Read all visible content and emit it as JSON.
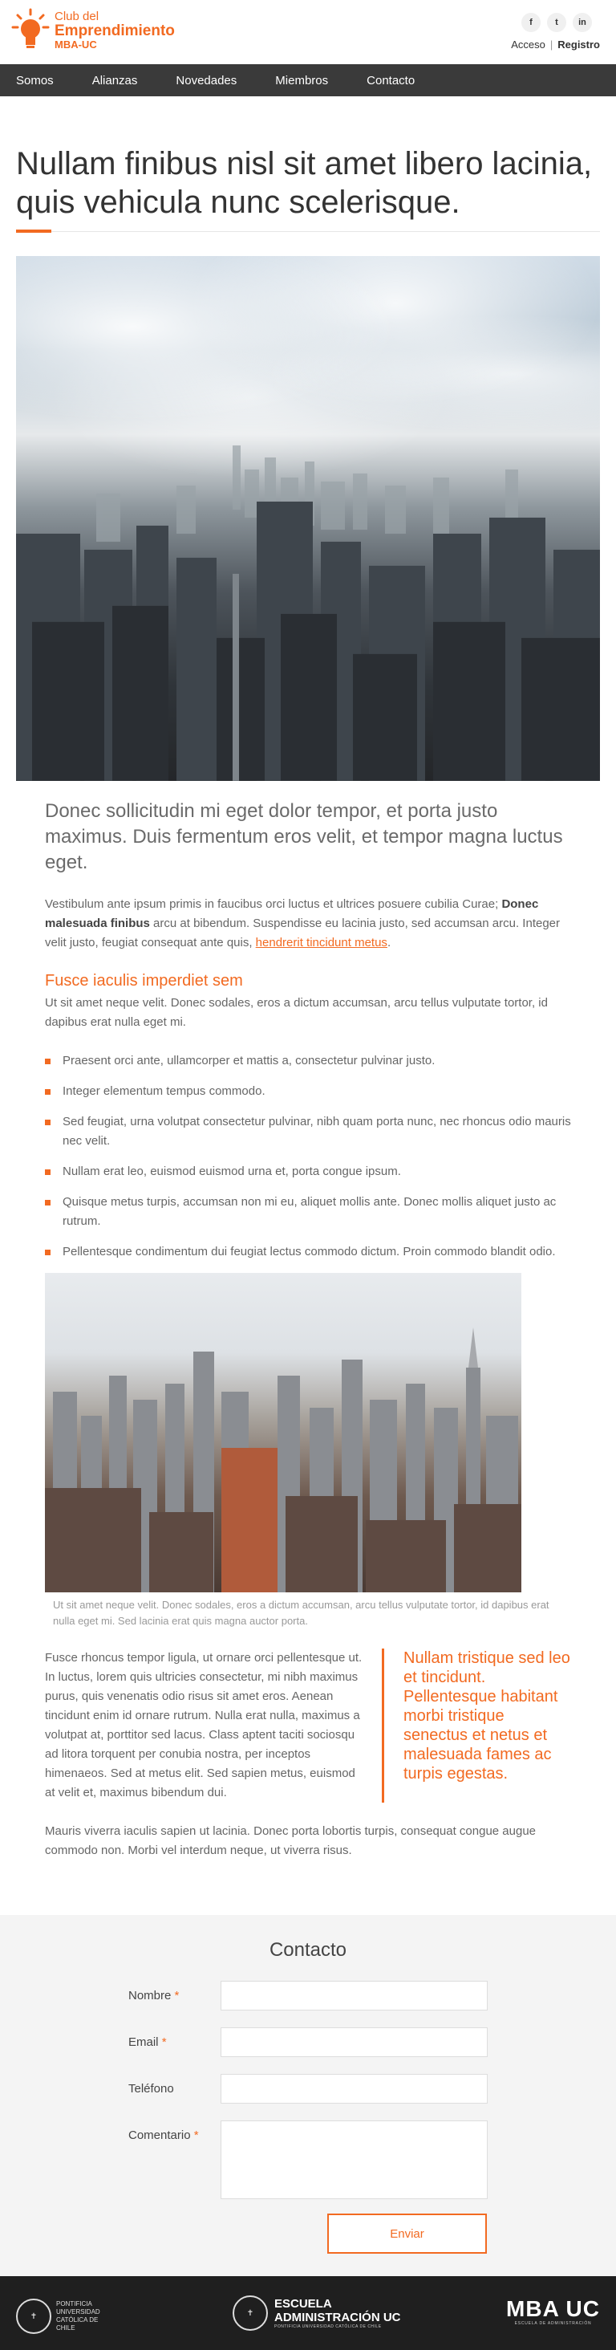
{
  "brand": {
    "line1": "Club del",
    "line2": "Emprendimiento",
    "line3": "MBA-UC",
    "accent": "#f26a21"
  },
  "social": [
    "f",
    "t",
    "in"
  ],
  "auth": {
    "login": "Acceso",
    "separator": "|",
    "register": "Registro"
  },
  "nav": [
    "Somos",
    "Alianzas",
    "Novedades",
    "Miembros",
    "Contacto"
  ],
  "article": {
    "title": "Nullam finibus nisl sit amet libero lacinia, quis vehicula nunc scelerisque.",
    "lead": "Donec sollicitudin mi eget dolor tempor, et porta justo maximus. Duis fermentum eros velit, et tempor magna luctus eget.",
    "para1_a": "Vestibulum ante ipsum primis in faucibus orci luctus et ultrices posuere cubilia Curae; ",
    "para1_bold": "Donec malesuada finibus",
    "para1_b": " arcu at bibendum. Suspendisse eu lacinia justo, sed accumsan arcu. Integer velit justo, feugiat consequat ante quis, ",
    "para1_link": "hendrerit tincidunt metus",
    "para1_end": ".",
    "subheading": "Fusce iaculis imperdiet sem",
    "para2": "Ut sit amet neque velit. Donec sodales, eros a dictum accumsan, arcu tellus vulputate tortor, id dapibus erat nulla eget mi.",
    "list": [
      "Praesent orci ante, ullamcorper et mattis a, consectetur pulvinar justo.",
      "Integer elementum tempus commodo.",
      "Sed feugiat, urna volutpat consectetur pulvinar, nibh quam porta nunc, nec rhoncus odio mauris nec velit.",
      "Nullam erat leo, euismod euismod urna et, porta congue ipsum.",
      "Quisque metus turpis, accumsan non mi eu, aliquet mollis ante. Donec mollis aliquet justo ac rutrum.",
      "Pellentesque condimentum dui feugiat lectus commodo dictum. Proin commodo blandit odio."
    ],
    "caption": "Ut sit amet neque velit. Donec sodales, eros a dictum accumsan, arcu tellus vulputate tortor, id dapibus erat nulla eget mi. Sed lacinia erat quis magna auctor porta.",
    "para3": "Fusce rhoncus tempor ligula, ut ornare orci pellentesque ut. In luctus, lorem quis ultricies consectetur, mi nibh maximus purus, quis venenatis odio risus sit amet eros. Aenean tincidunt enim id ornare rutrum. Nulla erat nulla, maximus a volutpat at, porttitor sed lacus. Class aptent taciti sociosqu ad litora torquent per conubia nostra, per inceptos himenaeos. Sed at metus elit. Sed sapien metus, euismod at velit et, maximus bibendum dui.",
    "pullquote": "Nullam tristique sed leo et tincidunt. Pellentesque habitant morbi tristique senectus et netus et malesuada fames ac turpis egestas.",
    "para4": "Mauris viverra iaculis sapien ut lacinia. Donec porta lobortis turpis, consequat congue augue commodo non. Morbi vel interdum neque, ut viverra risus."
  },
  "contact": {
    "heading": "Contacto",
    "fields": [
      {
        "label": "Nombre",
        "required": "*"
      },
      {
        "label": "Email",
        "required": "*"
      },
      {
        "label": "Teléfono",
        "required": ""
      },
      {
        "label": "Comentario",
        "required": "*"
      }
    ],
    "submit": "Enviar"
  },
  "footer": {
    "puc": "PONTIFICIA UNIVERSIDAD CATÓLICA DE CHILE",
    "escuela1": "ESCUELA",
    "escuela2": "ADMINISTRACIÓN UC",
    "escuela_sub": "PONTIFICIA UNIVERSIDAD CATÓLICA DE CHILE",
    "mba": "MBA UC",
    "mba_sub": "ESCUELA DE ADMINISTRACIÓN"
  }
}
